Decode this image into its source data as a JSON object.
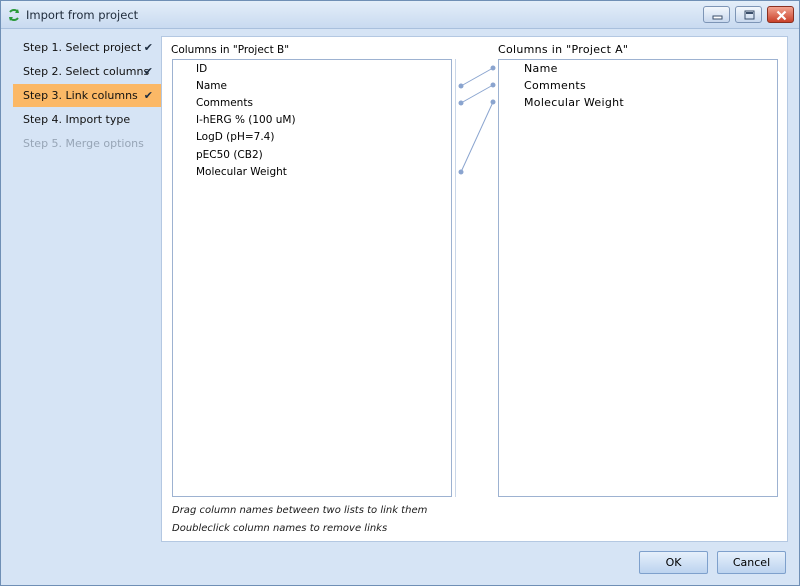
{
  "window": {
    "title": "Import from project"
  },
  "sidebar": {
    "steps": [
      {
        "label": "Step 1. Select project",
        "check": "✔"
      },
      {
        "label": "Step 2. Select columns",
        "check": "✔"
      },
      {
        "label": "Step 3. Link columns",
        "check": "✔"
      },
      {
        "label": "Step 4. Import type",
        "check": ""
      },
      {
        "label": "Step 5. Merge options",
        "check": ""
      }
    ],
    "active_step": 3
  },
  "left_list": {
    "label": "Columns in \"Project B\"",
    "items": [
      "ID",
      "Name",
      "Comments",
      "I-hERG % (100 uM)",
      "LogD (pH=7.4)",
      "pEC50 (CB2)",
      "Molecular Weight"
    ]
  },
  "right_list": {
    "label": "Columns in \"Project A\"",
    "items": [
      "Name",
      "Comments",
      "Molecular Weight"
    ]
  },
  "links": [
    {
      "from": "Name",
      "to": "Name"
    },
    {
      "from": "Comments",
      "to": "Comments"
    },
    {
      "from": "Molecular Weight",
      "to": "Molecular Weight"
    }
  ],
  "hints": {
    "drag": "Drag column names between two lists to link them",
    "doubleclick": "Doubleclick column names to remove links"
  },
  "buttons": {
    "ok": "OK",
    "cancel": "Cancel"
  },
  "colors": {
    "active_step_bg": "#fbb866",
    "link_line": "#8aa4cf",
    "window_bg": "#d6e4f5"
  }
}
